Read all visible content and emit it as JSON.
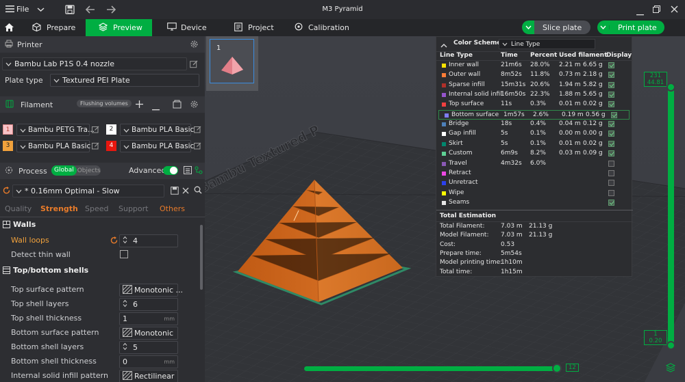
{
  "window": {
    "title": "M3 Pyramid",
    "file_menu": "File"
  },
  "nav": {
    "tabs": [
      {
        "label": "Prepare",
        "icon": "cube-icon"
      },
      {
        "label": "Preview",
        "icon": "layers-icon",
        "active": true
      },
      {
        "label": "Device",
        "icon": "monitor-icon"
      },
      {
        "label": "Project",
        "icon": "document-icon"
      },
      {
        "label": "Calibration",
        "icon": "gauge-icon"
      }
    ],
    "slice_label": "Slice plate",
    "print_label": "Print plate"
  },
  "colors": {
    "accent": "#00ae42",
    "slice_button": "#4a4c52",
    "filament_orange": "#c8651c",
    "warning_label": "#f2a23c"
  },
  "printer": {
    "section_label": "Printer",
    "name": "Bambu Lab P1S 0.4 nozzle",
    "plate_type_label": "Plate type",
    "plate_type": "Textured PEI Plate"
  },
  "filament": {
    "section_label": "Filament",
    "flushing_label": "Flushing volumes",
    "slots": [
      {
        "num": "1",
        "name": "Bambu PETG Tra...",
        "color": "#f7c3c8"
      },
      {
        "num": "2",
        "name": "Bambu PLA Basic",
        "color": "#ffffff"
      },
      {
        "num": "3",
        "name": "Bambu PLA Basic",
        "color": "#f2a23c"
      },
      {
        "num": "4",
        "name": "Bambu PLA Basic",
        "color": "#e8170f"
      }
    ]
  },
  "process": {
    "section_label": "Process",
    "global_label": "Global",
    "objects_label": "Objects",
    "advanced_label": "Advanced",
    "preset": "* 0.16mm Optimal - Slow",
    "tabs": [
      "Quality",
      "Strength",
      "Speed",
      "Support",
      "Others"
    ],
    "active_tab": "Strength",
    "walls": {
      "title": "Walls",
      "wall_loops_label": "Wall loops",
      "wall_loops": "4",
      "detect_thin_label": "Detect thin wall"
    },
    "shells": {
      "title": "Top/bottom shells",
      "rows": [
        {
          "label": "Top surface pattern",
          "value": "Monotonic ...",
          "kind": "pattern"
        },
        {
          "label": "Top shell layers",
          "value": "6",
          "kind": "spin"
        },
        {
          "label": "Top shell thickness",
          "value": "1",
          "unit": "mm",
          "kind": "unit"
        },
        {
          "label": "Bottom surface pattern",
          "value": "Monotonic",
          "kind": "pattern"
        },
        {
          "label": "Bottom shell layers",
          "value": "5",
          "kind": "spin"
        },
        {
          "label": "Bottom shell thickness",
          "value": "0",
          "unit": "mm",
          "kind": "unit"
        },
        {
          "label": "Internal solid infill pattern",
          "value": "Rectilinear",
          "kind": "pattern"
        }
      ]
    }
  },
  "preview": {
    "plate_number": "1",
    "bed_text": "Bambu Textured P",
    "layer_top": "231",
    "height_top": "44.81",
    "layer_bottom": "1",
    "height_bottom": "0.20",
    "move_value": "12",
    "move_progress": 1.0
  },
  "legend": {
    "scheme_label": "Color Scheme",
    "scheme_value": "Line Type",
    "headers": [
      "Line Type",
      "Time",
      "Percent",
      "Used filament",
      "Display"
    ],
    "rows": [
      {
        "name": "Inner wall",
        "color": "#ffe300",
        "time": "21m6s",
        "percent": "28.0%",
        "len": "2.21 m",
        "weight": "6.65 g",
        "display": true
      },
      {
        "name": "Outer wall",
        "color": "#ff7d38",
        "time": "8m52s",
        "percent": "11.8%",
        "len": "0.73 m",
        "weight": "2.18 g",
        "display": true
      },
      {
        "name": "Sparse infill",
        "color": "#b03029",
        "time": "15m31s",
        "percent": "20.6%",
        "len": "1.94 m",
        "weight": "5.82 g",
        "display": true
      },
      {
        "name": "Internal solid infill",
        "color": "#9654cc",
        "time": "16m50s",
        "percent": "22.3%",
        "len": "1.88 m",
        "weight": "5.65 g",
        "display": true
      },
      {
        "name": "Top surface",
        "color": "#f04040",
        "time": "11s",
        "percent": "0.3%",
        "len": "0.01 m",
        "weight": "0.02 g",
        "display": true
      },
      {
        "name": "Bottom surface",
        "color": "#7d7df2",
        "time": "1m57s",
        "percent": "2.6%",
        "len": "0.19 m",
        "weight": "0.56 g",
        "display": true
      },
      {
        "name": "Bridge",
        "color": "#4d80ba",
        "time": "18s",
        "percent": "0.4%",
        "len": "0.04 m",
        "weight": "0.12 g",
        "display": true
      },
      {
        "name": "Gap infill",
        "color": "#ffffff",
        "time": "5s",
        "percent": "0.1%",
        "len": "0.00 m",
        "weight": "0.00 g",
        "display": true
      },
      {
        "name": "Skirt",
        "color": "#00876e",
        "time": "5s",
        "percent": "0.1%",
        "len": "0.01 m",
        "weight": "0.02 g",
        "display": true
      },
      {
        "name": "Custom",
        "color": "#5ed194",
        "time": "6m9s",
        "percent": "8.2%",
        "len": "0.03 m",
        "weight": "0.09 g",
        "display": true
      },
      {
        "name": "Travel",
        "color": "#8a59b5",
        "time": "4m32s",
        "percent": "6.0%",
        "len": "",
        "weight": "",
        "display": false
      },
      {
        "name": "Retract",
        "color": "#ed48e3",
        "time": "",
        "percent": "",
        "len": "",
        "weight": "",
        "display": false
      },
      {
        "name": "Unretract",
        "color": "#2b41ed",
        "time": "",
        "percent": "",
        "len": "",
        "weight": "",
        "display": false
      },
      {
        "name": "Wipe",
        "color": "#ffff00",
        "time": "",
        "percent": "",
        "len": "",
        "weight": "",
        "display": false
      },
      {
        "name": "Seams",
        "color": "#e6e6e6",
        "time": "",
        "percent": "",
        "len": "",
        "weight": "",
        "display": true
      }
    ],
    "total_title": "Total Estimation",
    "totals": [
      {
        "label": "Total Filament:",
        "v1": "7.03 m",
        "v2": "21.13 g"
      },
      {
        "label": "Model Filament:",
        "v1": "7.03 m",
        "v2": "21.13 g"
      },
      {
        "label": "Cost:",
        "v1": "0.53",
        "v2": ""
      },
      {
        "label": "Prepare time:",
        "v1": "5m54s",
        "v2": ""
      },
      {
        "label": "Model printing time:",
        "v1": "1h10m",
        "v2": ""
      },
      {
        "label": "Total time:",
        "v1": "1h15m",
        "v2": ""
      }
    ]
  }
}
